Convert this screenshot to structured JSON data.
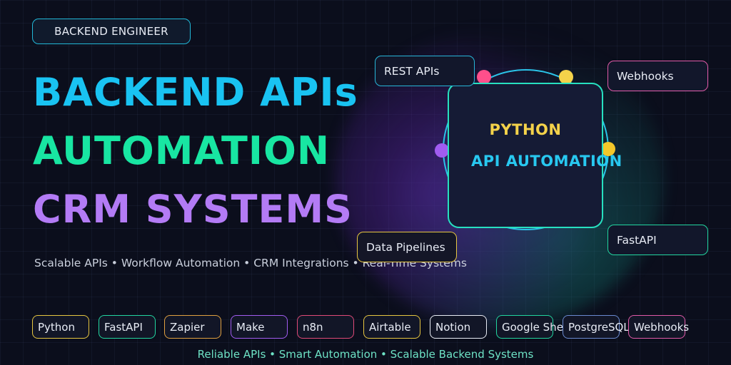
{
  "badge": "BACKEND ENGINEER",
  "headlines": [
    "BACKEND APIs",
    "AUTOMATION",
    "CRM SYSTEMS"
  ],
  "subtitle": "Scalable APIs • Workflow Automation • CRM Integrations • Real-Time Systems",
  "core": {
    "title": "PYTHON",
    "subtitle": "API AUTOMATION"
  },
  "floating_tags": [
    "REST APIs",
    "Webhooks",
    "Data Pipelines",
    "FastAPI"
  ],
  "tech_pills": [
    "Python",
    "FastAPI",
    "Zapier",
    "Make",
    "n8n",
    "Airtable",
    "Notion",
    "Google Sheets",
    "PostgreSQL",
    "Webhooks"
  ],
  "footer": "Reliable APIs • Smart Automation • Scalable Backend Systems",
  "colors": {
    "background": "#0b0e1c",
    "cyan": "#19c3f2",
    "green": "#18e6a2",
    "purple": "#b37bf5",
    "yellow": "#f4d24a",
    "pink": "#ff4f8b"
  }
}
